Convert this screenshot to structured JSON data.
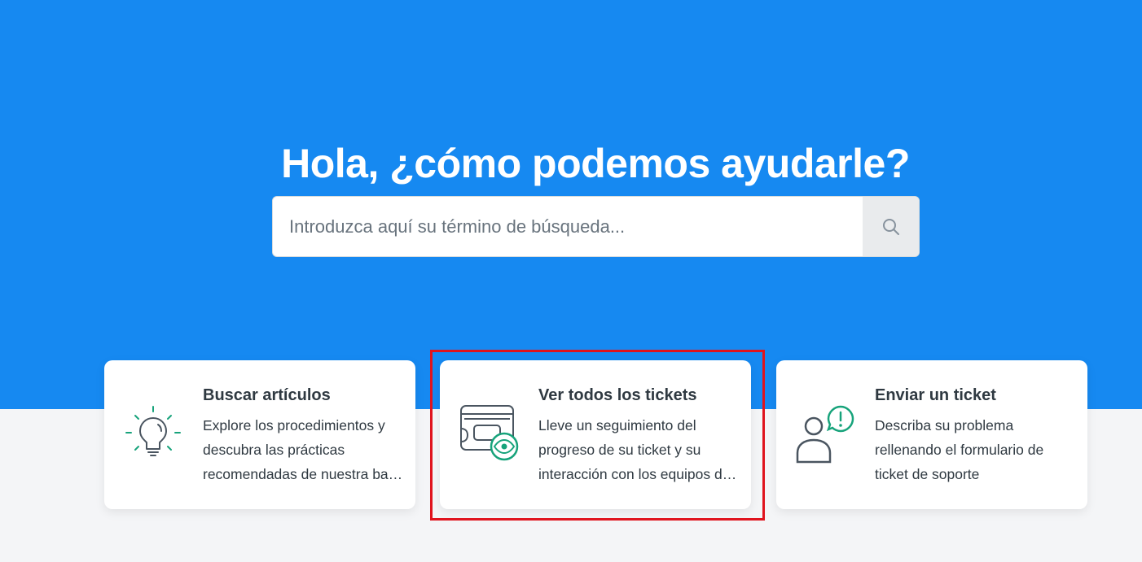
{
  "hero": {
    "title": "Hola, ¿cómo podemos ayudarle?",
    "background_color": "#1689f1"
  },
  "search": {
    "placeholder": "Introduzca aquí su término de búsqueda...",
    "value": "",
    "button_icon": "search-icon"
  },
  "cards": [
    {
      "icon": "lightbulb-icon",
      "title": "Buscar artículos",
      "description": "Explore los procedimientos y descubra las prácticas recomendadas de nuestra base de conocimientos"
    },
    {
      "icon": "tickets-view-icon",
      "title": "Ver todos los tickets",
      "description": "Lleve un seguimiento del progreso de su ticket y su interacción con los equipos de soporte"
    },
    {
      "icon": "user-alert-icon",
      "title": "Enviar un ticket",
      "description": "Describa su problema rellenando el formulario de ticket de soporte"
    }
  ],
  "colors": {
    "accent_green": "#17a37b",
    "icon_stroke": "#4a5560",
    "highlight_red": "#e0141e"
  }
}
